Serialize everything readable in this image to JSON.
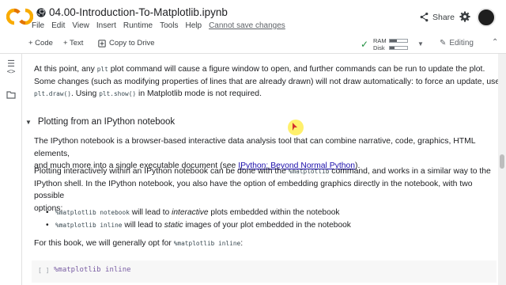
{
  "header": {
    "notebook_title": "04.00-Introduction-To-Matplotlib.ipynb",
    "menu": [
      "File",
      "Edit",
      "View",
      "Insert",
      "Runtime",
      "Tools",
      "Help"
    ],
    "cannot_save": "Cannot save changes",
    "share_label": "Share"
  },
  "toolbar": {
    "code_label": "+ Code",
    "text_label": "+ Text",
    "copy_drive_label": "Copy to Drive",
    "ram_label": "RAM",
    "disk_label": "Disk",
    "editing_label": "Editing"
  },
  "content": {
    "p1a": "At this point, any ",
    "p1_code1": "plt",
    "p1b": " plot command will cause a figure window to open, and further commands can be run to update the plot.",
    "p1c": "Some changes (such as modifying properties of lines that are already drawn) will not draw automatically: to force an update, use",
    "p1_code2": "plt.draw()",
    "p1d": ". Using ",
    "p1_code3": "plt.show()",
    "p1e": " in Matplotlib mode is not required.",
    "section_title": "Plotting from an IPython notebook",
    "p2a": "The IPython notebook is a browser-based interactive data analysis tool that can combine narrative, code, graphics, HTML elements,",
    "p2b": "and much more into a single executable document (see ",
    "p2_link": "IPython: Beyond Normal Python",
    "p2c": ").",
    "p3a": "Plotting interactively within an IPython notebook can be done with the ",
    "p3_code": "%matplotlib",
    "p3b": " command, and works in a similar way to the",
    "p3c": "IPython shell. In the IPython notebook, you also have the option of embedding graphics directly in the notebook, with two possible",
    "p3d": "options:",
    "bullet1_code": "%matplotlib notebook",
    "bullet1_a": " will lead to ",
    "bullet1_em": "interactive",
    "bullet1_b": " plots embedded within the notebook",
    "bullet2_code": "%matplotlib inline",
    "bullet2_a": " will lead to ",
    "bullet2_em": "static",
    "bullet2_b": " images of your plot embedded in the notebook",
    "p4a": "For this book, we will generally opt for ",
    "p4_code": "%matplotlib inline",
    "p4b": ":",
    "cell_brackets": "[ ]",
    "cell_source": "%matplotlib inline"
  },
  "status": {
    "ram_fraction": 0.4,
    "disk_fraction": 0.25
  },
  "colors": {
    "accent_orange": "#f9ab00",
    "link": "#1a0dab",
    "check_green": "#1e8e3e"
  }
}
